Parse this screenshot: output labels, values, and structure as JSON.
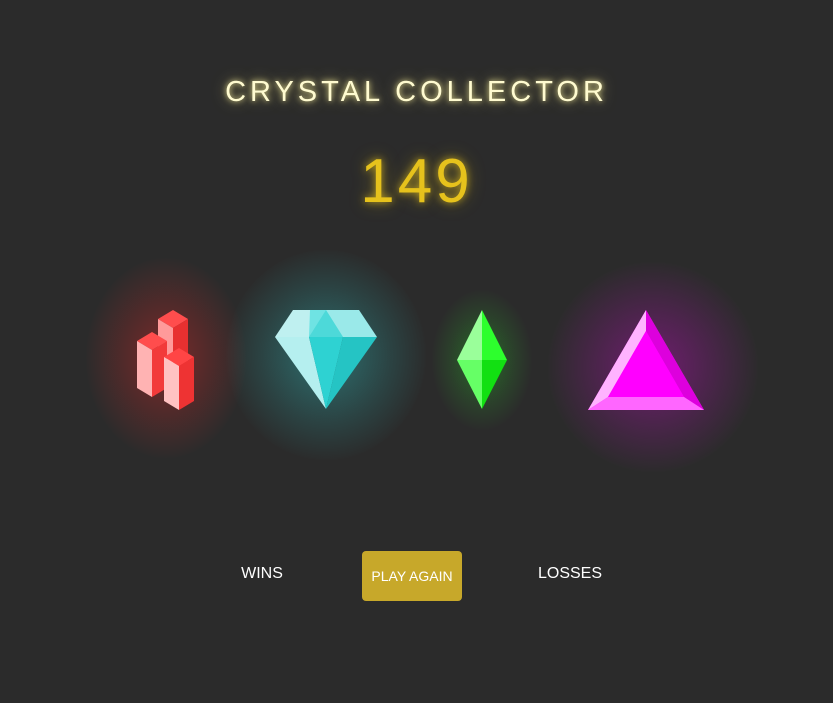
{
  "header": {
    "title": "CRYSTAL COLLECTOR"
  },
  "game": {
    "target_score": "149"
  },
  "crystals": [
    {
      "name": "red crystal",
      "icon": "red-crystal-cluster-icon",
      "color": "#ff3333"
    },
    {
      "name": "cyan crystal",
      "icon": "cyan-diamond-icon",
      "color": "#2dd6d6"
    },
    {
      "name": "green crystal",
      "icon": "green-gem-icon",
      "color": "#22ff22"
    },
    {
      "name": "magenta crystal",
      "icon": "magenta-pyramid-icon",
      "color": "#ff00ff"
    }
  ],
  "footer": {
    "wins_label": "WINS",
    "play_again_label": "PLAY AGAIN",
    "losses_label": "LOSSES"
  },
  "colors": {
    "background": "#2b2b2b",
    "title": "#fffbd0",
    "score": "#e6c21c",
    "button": "#c7a82a"
  }
}
